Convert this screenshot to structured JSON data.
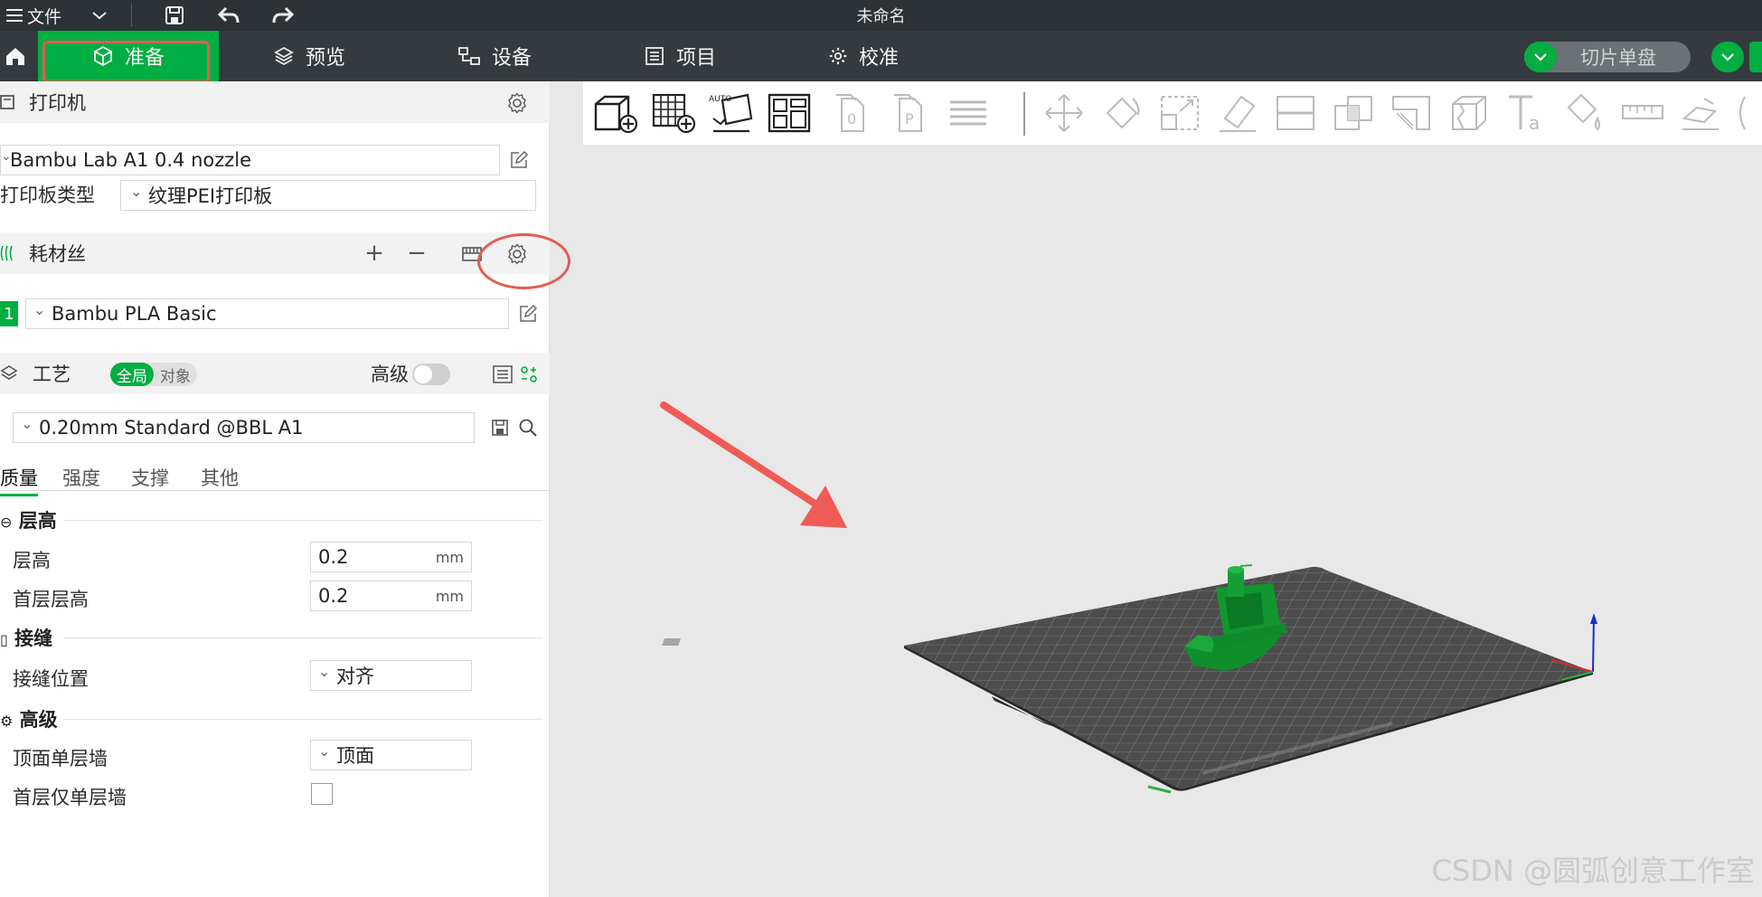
{
  "titlebar": {
    "file_menu": "文件",
    "window_title": "未命名"
  },
  "nav": {
    "tabs": [
      {
        "label": "准备",
        "icon": "cube-icon",
        "active": true
      },
      {
        "label": "预览",
        "icon": "layers-icon",
        "active": false
      },
      {
        "label": "设备",
        "icon": "device-icon",
        "active": false
      },
      {
        "label": "项目",
        "icon": "list-icon",
        "active": false
      },
      {
        "label": "校准",
        "icon": "gear-icon",
        "active": false
      }
    ],
    "slice_button": "切片单盘"
  },
  "printer": {
    "section_title": "打印机",
    "printer_name": "Bambu Lab A1 0.4 nozzle",
    "plate_label": "打印板类型",
    "plate_value": "纹理PEI打印板"
  },
  "filament": {
    "section_title": "耗材丝",
    "slot_number": "1",
    "filament_name": "Bambu PLA Basic"
  },
  "process": {
    "section_title": "工艺",
    "toggle_global": "全局",
    "toggle_object": "对象",
    "advanced_label": "高级",
    "preset_name": "0.20mm Standard @BBL A1",
    "tabs": [
      "质量",
      "强度",
      "支撑",
      "其他"
    ],
    "groups": {
      "layer_height": {
        "title": "层高",
        "rows": [
          {
            "label": "层高",
            "value": "0.2",
            "unit": "mm"
          },
          {
            "label": "首层层高",
            "value": "0.2",
            "unit": "mm"
          }
        ]
      },
      "seam": {
        "title": "接缝",
        "rows": [
          {
            "label": "接缝位置",
            "value": "对齐"
          }
        ]
      },
      "advanced": {
        "title": "高级",
        "rows": [
          {
            "label": "顶面单层墙",
            "value": "顶面"
          },
          {
            "label": "首层仅单层墙",
            "value": ""
          }
        ]
      }
    }
  },
  "watermark": "CSDN @圆弧创意工作室",
  "colors": {
    "accent": "#00ae42",
    "annotation": "#e35c52",
    "titlebar": "#2c3235",
    "nav": "#343a3e"
  }
}
